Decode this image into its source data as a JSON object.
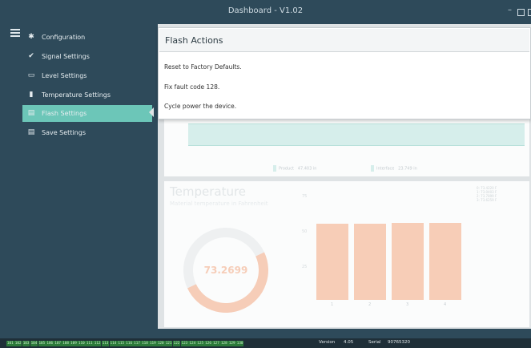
{
  "window": {
    "title": "Dashboard - V1.02",
    "minimize_glyph": "–"
  },
  "sidebar": {
    "items": [
      {
        "label": "Configuration",
        "icon": "gear-icon",
        "glyph": "✱"
      },
      {
        "label": "Signal Settings",
        "icon": "signal-icon",
        "glyph": "✔"
      },
      {
        "label": "Level Settings",
        "icon": "level-icon",
        "glyph": "▭"
      },
      {
        "label": "Temperature Settings",
        "icon": "thermometer-icon",
        "glyph": "▮"
      },
      {
        "label": "Flash Settings",
        "icon": "flash-memory-icon",
        "glyph": "▤",
        "active": true
      },
      {
        "label": "Save Settings",
        "icon": "save-icon",
        "glyph": "▤"
      }
    ]
  },
  "level_card": {
    "legend_product": "Product",
    "product_value": "47.403 in",
    "legend_interface": "Interface",
    "interface_value": "23.749 in"
  },
  "temperature_card": {
    "title": "Temperature",
    "subtitle": "Material temperature in Fahrenheit",
    "gauge_value": "73.2699",
    "y_ticks": [
      "75",
      "50",
      "25"
    ],
    "legend_lines": [
      "0: 73.4220 F",
      "1: 73.0403 F",
      "2: 73.7899 F",
      "3: 73.6259 F"
    ]
  },
  "chart_data": {
    "type": "bar",
    "categories": [
      "1",
      "2",
      "3",
      "4"
    ],
    "values": [
      73.4,
      73.0,
      73.8,
      73.6
    ],
    "ylim": [
      0,
      100
    ]
  },
  "popup": {
    "title": "Flash Actions",
    "actions": [
      "Reset to Factory Defaults.",
      "Fix fault code 128.",
      "Cycle power the device."
    ]
  },
  "statusbar": {
    "registers": [
      "101",
      "102",
      "103",
      "104",
      "105",
      "106",
      "107",
      "108",
      "109",
      "110",
      "111",
      "112",
      "113",
      "114",
      "115",
      "116",
      "117",
      "118",
      "119",
      "120",
      "121",
      "122",
      "123",
      "124",
      "125",
      "126",
      "127",
      "128",
      "129",
      "130"
    ],
    "version_label": "Version",
    "version_value": "4.05",
    "serial_label": "Serial",
    "serial_value": "90765320"
  },
  "colors": {
    "sidebar_bg": "#2e4a5a",
    "active_item": "#6cc6b8",
    "bar_fill": "#f7cdb7",
    "register_bg": "#2c7a3a"
  }
}
